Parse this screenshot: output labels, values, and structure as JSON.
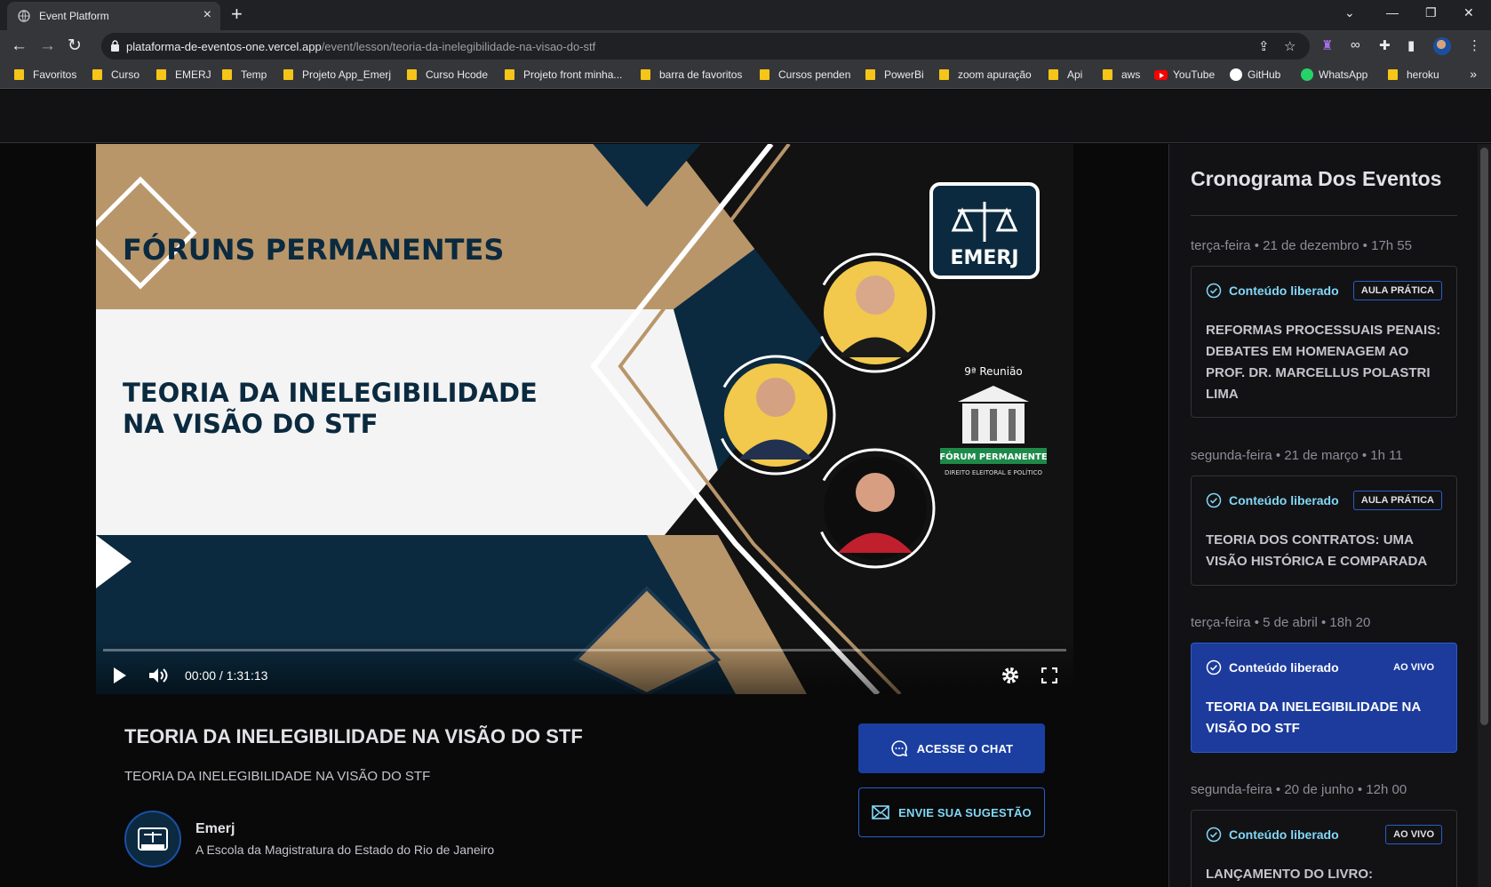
{
  "browser": {
    "tab_title": "Event Platform",
    "url_host": "plataforma-de-eventos-one.vercel.app",
    "url_path": "/event/lesson/teoria-da-inelegibilidade-na-visao-do-stf",
    "bookmarks": [
      {
        "label": "Favoritos",
        "icon": "folder-icon"
      },
      {
        "label": "Curso",
        "icon": "folder-icon"
      },
      {
        "label": "EMERJ",
        "icon": "folder-icon"
      },
      {
        "label": "Temp",
        "icon": "folder-icon"
      },
      {
        "label": "Projeto App_Emerj",
        "icon": "folder-icon"
      },
      {
        "label": "Curso Hcode",
        "icon": "folder-icon"
      },
      {
        "label": "Projeto front minha...",
        "icon": "folder-icon"
      },
      {
        "label": "barra de favoritos",
        "icon": "folder-icon"
      },
      {
        "label": "Cursos penden",
        "icon": "folder-icon"
      },
      {
        "label": "PowerBi",
        "icon": "folder-icon"
      },
      {
        "label": "zoom apuração",
        "icon": "folder-icon"
      },
      {
        "label": "Api",
        "icon": "folder-icon"
      },
      {
        "label": "aws",
        "icon": "folder-icon"
      },
      {
        "label": "YouTube",
        "icon": "youtube-icon"
      },
      {
        "label": "GitHub",
        "icon": "github-icon"
      },
      {
        "label": "WhatsApp",
        "icon": "whatsapp-icon"
      },
      {
        "label": "heroku",
        "icon": "folder-icon"
      }
    ]
  },
  "video": {
    "thumb_heading": "FÓRUNS PERMANENTES",
    "thumb_title_line1": "TEORIA DA INELEGIBILIDADE",
    "thumb_title_line2": "NA VISÃO DO STF",
    "thumb_logo": "EMERJ",
    "thumb_meeting": "9ª Reunião",
    "thumb_forum": "FÓRUM PERMANENTE",
    "thumb_forum_sub": "DIREITO ELEITORAL E POLÍTICO",
    "time": "00:00 / 1:31:13",
    "progress_fraction": 0
  },
  "lesson": {
    "title": "TEORIA DA INELEGIBILIDADE NA VISÃO DO STF",
    "description": "TEORIA DA INELEGIBILIDADE NA VISÃO DO STF",
    "teacher_name": "Emerj",
    "teacher_bio": "A Escola da Magistratura do Estado do Rio de Janeiro",
    "chat_button": "ACESSE O CHAT",
    "suggestion_button": "ENVIE SUA SUGESTÃO"
  },
  "sidebar": {
    "title": "Cronograma Dos Eventos",
    "events": [
      {
        "date": "terça-feira • 21 de dezembro • 17h 55",
        "status": "Conteúdo liberado",
        "badge": "AULA PRÁTICA",
        "title": "REFORMAS PROCESSUAIS PENAIS: DEBATES EM HOMENAGEM AO PROF. DR. MARCELLUS POLASTRI LIMA",
        "active": false
      },
      {
        "date": "segunda-feira • 21 de março • 1h 11",
        "status": "Conteúdo liberado",
        "badge": "AULA PRÁTICA",
        "title": "TEORIA DOS CONTRATOS: UMA VISÃO HISTÓRICA E COMPARADA",
        "active": false
      },
      {
        "date": "terça-feira • 5 de abril • 18h 20",
        "status": "Conteúdo liberado",
        "badge": "AO VIVO",
        "title": "TEORIA DA INELEGIBILIDADE NA VISÃO DO STF",
        "active": true
      },
      {
        "date": "segunda-feira • 20 de junho • 12h 00",
        "status": "Conteúdo liberado",
        "badge": "AO VIVO",
        "title": "LANÇAMENTO DO LIVRO:",
        "active": false
      }
    ]
  },
  "colors": {
    "accent_blue": "#1b3fa1",
    "accent_cyan": "#81d8f7",
    "brand_navy": "#0b2a3f",
    "brand_gold": "#b8966a"
  }
}
